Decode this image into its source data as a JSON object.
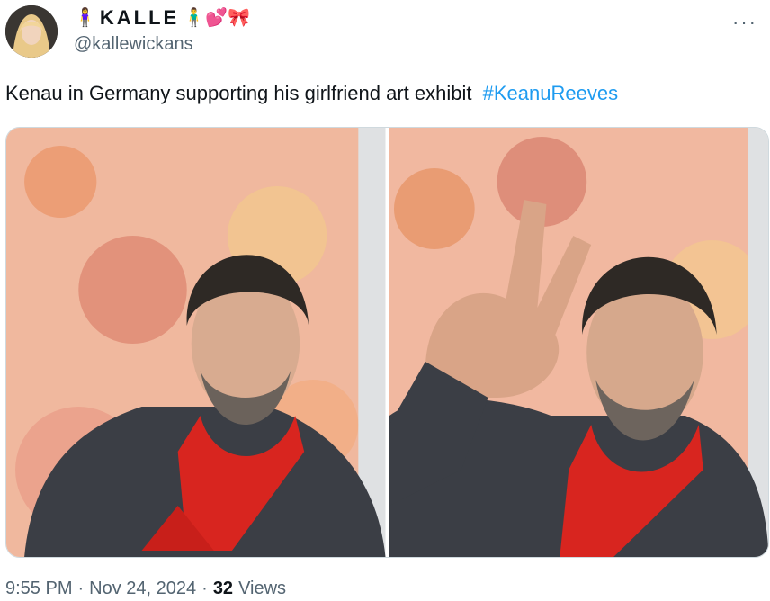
{
  "author": {
    "display_name": "KALLE",
    "emoji_before": "🧍‍♀️",
    "emoji_after": "🧍‍♂️💕🎀",
    "handle": "@kallewickans"
  },
  "icons": {
    "more": "more-horizontal-icon"
  },
  "tweet": {
    "text": "Kenau in Germany supporting his girlfriend art exhibit",
    "hashtag": "#KeanuReeves"
  },
  "meta": {
    "time": "9:55 PM",
    "sep1": "·",
    "date": "Nov 24, 2024",
    "sep2": "·",
    "views_count": "32",
    "views_label": "Views"
  },
  "colors": {
    "link": "#1d9bf0",
    "secondary_text": "#536471",
    "primary_text": "#0f1419",
    "scarf": "#d8251f",
    "coat": "#3b3e45"
  }
}
